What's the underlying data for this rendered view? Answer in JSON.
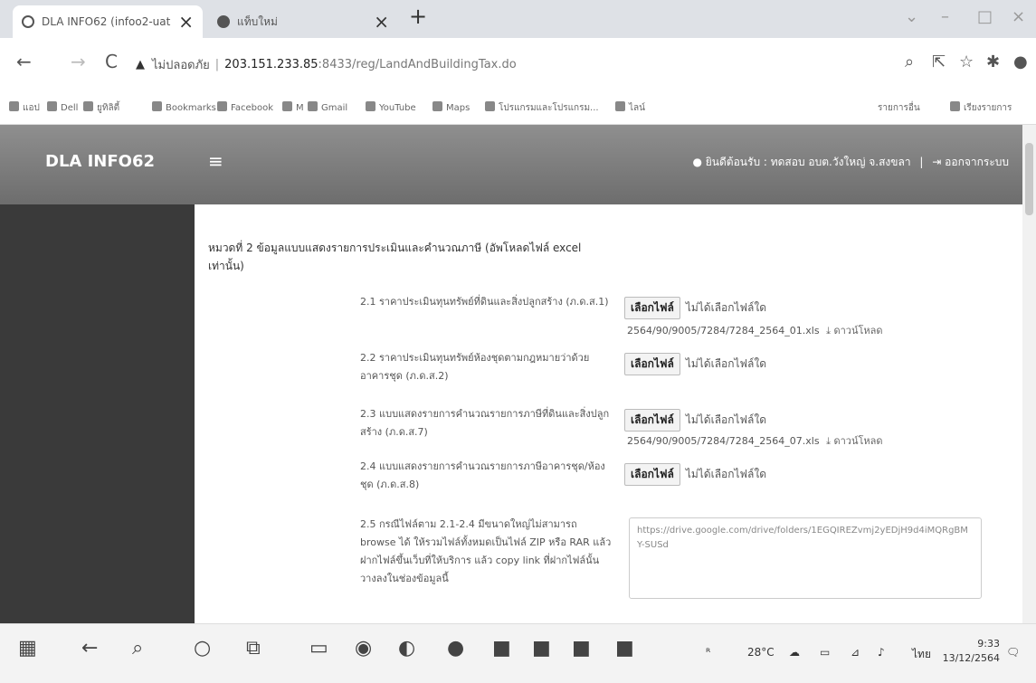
{
  "browser": {
    "tabs": [
      {
        "title": "DLA INFO62 (infoo2-uat)",
        "active": true
      },
      {
        "title": "แท็บใหม่",
        "active": false
      }
    ],
    "new_tab": "+",
    "close_glyph": "×",
    "back_glyph": "←",
    "forward_glyph": "→",
    "reload_glyph": "C",
    "warning_glyph": "▲",
    "not_secure_label": "ไม่ปลอดภัย",
    "url_host": "203.151.233.85",
    "url_path": ":8433/reg/LandAndBuildingTax.do",
    "bookmarks": [
      "แอป",
      "Dell",
      "ยูทิลิตี้",
      "Bookmarks",
      "Facebook",
      "M",
      "Gmail",
      "YouTube",
      "Maps",
      "โปรแกรมและโปรแกรม...",
      "ไลน์"
    ],
    "bookmarks_right": [
      "รายการอื่น",
      "เรียงรายการ"
    ]
  },
  "header": {
    "brand": "DLA INFO62",
    "menu_glyph": "≡",
    "welcome": "ยินดีต้อนรับ : ทดสอบ อบต.วังใหญ่ จ.สงขลา",
    "separator": "|",
    "logout": "ออกจากระบบ"
  },
  "content": {
    "section_title": "หมวดที่ 2 ข้อมูลแบบแสดงรายการประเมินและคำนวณภาษี (อัพโหลดไฟล์ excel เท่านั้น)",
    "choose_label": "เลือกไฟล์",
    "no_file_label": "ไม่ได้เลือกไฟล์ใด",
    "download_label": "ดาวน์โหลด",
    "rows": [
      {
        "label": "2.1 ราคาประเมินทุนทรัพย์ที่ดินและสิ่งปลูกสร้าง (ภ.ด.ส.1)",
        "file": "2564/90/9005/7284/7284_2564_01.xls"
      },
      {
        "label": "2.2 ราคาประเมินทุนทรัพย์ห้องชุดตามกฎหมายว่าด้วยอาคารชุด (ภ.ด.ส.2)",
        "file": ""
      },
      {
        "label": "2.3 แบบแสดงรายการคำนวณรายการภาษีที่ดินและสิ่งปลูกสร้าง (ภ.ด.ส.7)",
        "file": "2564/90/9005/7284/7284_2564_07.xls"
      },
      {
        "label": "2.4 แบบแสดงรายการคำนวณรายการภาษีอาคารชุด/ห้องชุด (ภ.ด.ส.8)",
        "file": ""
      }
    ],
    "row25_label": "2.5 กรณีไฟล์ตาม 2.1-2.4 มีขนาดใหญ่ไม่สามารถ browse ได้ ให้รวมไฟล์ทั้งหมดเป็นไฟล์ ZIP หรือ RAR แล้วฝากไฟล์ขึ้นเว็บที่ให้บริการ แล้ว copy link ที่ฝากไฟล์นั้น วางลงในช่องข้อมูลนี้",
    "link_value": "https://drive.google.com/drive/folders/1EGQIREZvmj2yEDjH9d4iMQRgBMY-SUSd"
  },
  "taskbar": {
    "weather": "28°C",
    "lang": "ไทย",
    "time": "9:33",
    "date": "13/12/2564"
  }
}
